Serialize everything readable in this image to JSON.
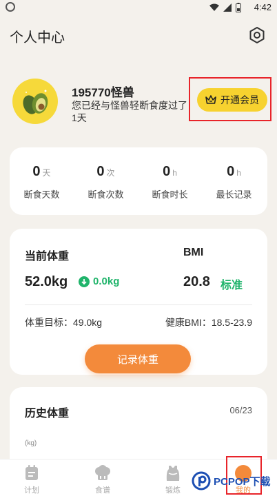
{
  "statusbar": {
    "time": "4:42"
  },
  "header": {
    "title": "个人中心"
  },
  "profile": {
    "username": "195770怪兽",
    "subtitle": "您已经与怪兽轻断食度过了1天",
    "vip_label": "开通会员"
  },
  "stats": [
    {
      "value": "0",
      "unit": "天",
      "label": "断食天数"
    },
    {
      "value": "0",
      "unit": "次",
      "label": "断食次数"
    },
    {
      "value": "0",
      "unit": "h",
      "label": "断食时长"
    },
    {
      "value": "0",
      "unit": "h",
      "label": "最长记录"
    }
  ],
  "weight": {
    "current_label": "当前体重",
    "current_value": "52.0kg",
    "delta": "0.0kg",
    "bmi_label": "BMI",
    "bmi_value": "20.8",
    "bmi_status": "标准",
    "goal": "体重目标：49.0kg",
    "healthy_bmi": "健康BMI：18.5-23.9",
    "record_button": "记录体重"
  },
  "history": {
    "title": "历史体重",
    "date": "06/23",
    "unit": "(kg)"
  },
  "tabs": [
    {
      "label": "计划",
      "icon": "calendar-icon"
    },
    {
      "label": "食谱",
      "icon": "chef-hat-icon"
    },
    {
      "label": "锻炼",
      "icon": "tank-top-icon"
    },
    {
      "label": "我的",
      "icon": "profile-icon"
    }
  ],
  "watermark": {
    "text": "PCPOP下载"
  },
  "colors": {
    "accent": "#f38a3b",
    "green": "#20b46b",
    "vip": "#f7d22f",
    "highlight": "#e8242a"
  }
}
